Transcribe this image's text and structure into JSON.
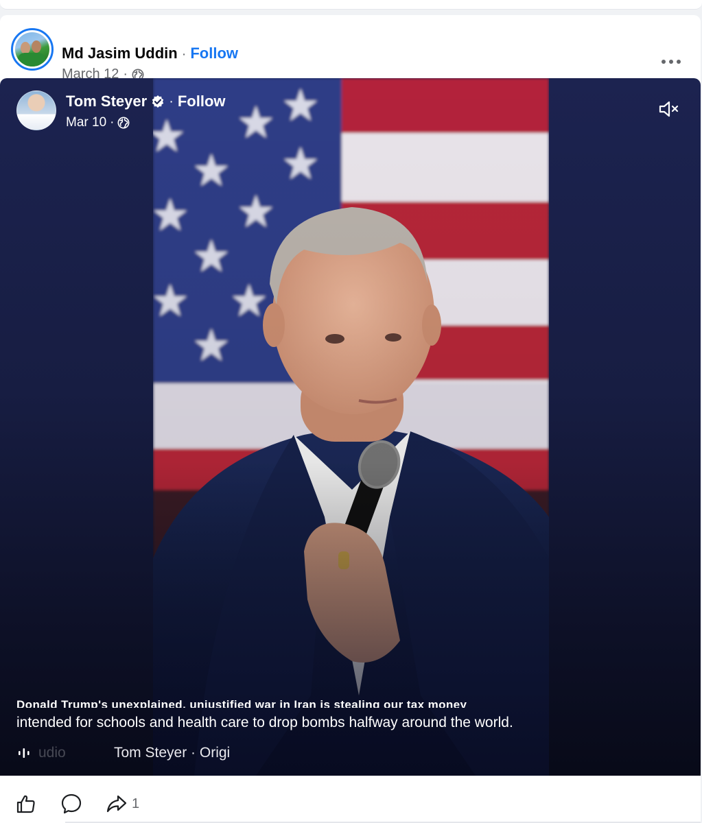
{
  "post": {
    "author": "Md Jasim Uddin",
    "follow_label": "Follow",
    "date": "March 12",
    "dot": "·"
  },
  "video": {
    "author": "Tom Steyer",
    "follow_label": "Follow",
    "date": "Mar 10",
    "dot": "·",
    "caption_top": "Donald Trump's unexplained, unjustified war in Iran is stealing our tax money",
    "caption_bottom": "intended for schools and health care to drop bombs halfway around the world.",
    "audio_label": "udio",
    "audio_track": "Tom Steyer · Origi"
  },
  "actions": {
    "share_count": "1"
  },
  "icons": {
    "globe": "globe-icon",
    "more": "more-options-icon",
    "verified": "verified-badge-icon",
    "mute": "muted-speaker-icon",
    "audio": "audio-wave-icon",
    "like": "like-thumb-icon",
    "comment": "comment-bubble-icon",
    "share": "share-arrow-icon"
  },
  "colors": {
    "accent": "#1877f2",
    "text_primary": "#050505",
    "text_secondary": "#65676b",
    "video_bg": "#171d42"
  }
}
